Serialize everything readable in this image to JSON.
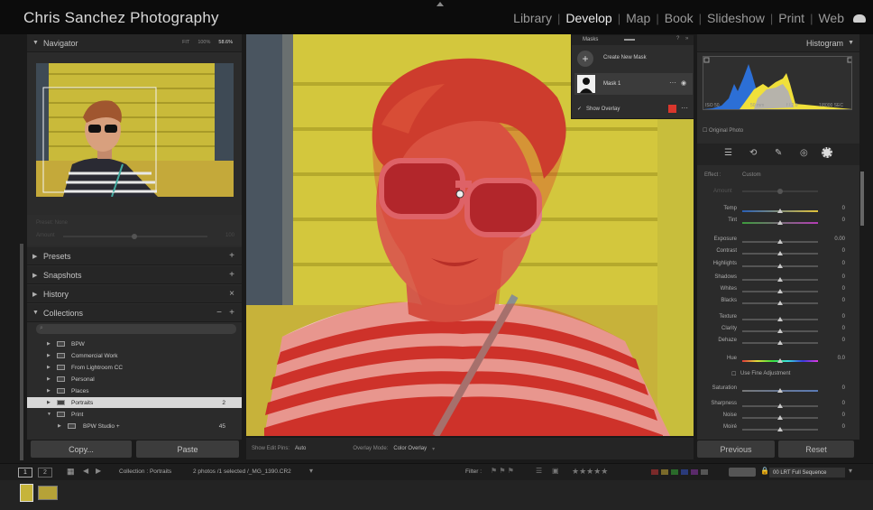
{
  "app_title": "Chris Sanchez Photography",
  "modules": [
    "Library",
    "Develop",
    "Map",
    "Book",
    "Slideshow",
    "Print",
    "Web"
  ],
  "active_module": "Develop",
  "navigator": {
    "title": "Navigator",
    "modes": [
      "FIT",
      "100%",
      "58.6%"
    ],
    "active_mode": "58.6%"
  },
  "preset_amount": {
    "label": "Preset: None",
    "amount_label": "Amount",
    "amount_value": "100"
  },
  "panels": {
    "presets": "Presets",
    "snapshots": "Snapshots",
    "history": "History",
    "collections": "Collections"
  },
  "collections": [
    {
      "label": "BPW",
      "count": ""
    },
    {
      "label": "Commercial Work",
      "count": ""
    },
    {
      "label": "From Lightroom CC",
      "count": ""
    },
    {
      "label": "Personal",
      "count": ""
    },
    {
      "label": "Places",
      "count": ""
    },
    {
      "label": "Portraits",
      "count": "2"
    },
    {
      "label": "Print",
      "count": ""
    },
    {
      "label": "BPW Studio +",
      "count": "45"
    }
  ],
  "left_buttons": {
    "copy": "Copy...",
    "paste": "Paste"
  },
  "masks": {
    "title": "Masks",
    "create_label": "Create New Mask",
    "mask1_label": "Mask 1",
    "show_overlay": "Show Overlay",
    "overlay_color": "#d9362c"
  },
  "toolbar": {
    "edit_pins_label": "Show Edit Pins:",
    "edit_pins_value": "Auto",
    "overlay_mode_label": "Overlay Mode:",
    "overlay_mode_value": "Color Overlay"
  },
  "histogram": {
    "title": "Histogram",
    "iso": "ISO 50",
    "focal": "50 mm",
    "aperture": "f / 2.0",
    "shutter": "1/8000 SEC",
    "original_photo": "Original Photo"
  },
  "effect": {
    "label": "Effect :",
    "value": "Custom",
    "amount_label": "Amount"
  },
  "sliders": [
    {
      "label": "Temp",
      "value": "0"
    },
    {
      "label": "Tint",
      "value": "0"
    },
    {
      "label": "Exposure",
      "value": "0.00"
    },
    {
      "label": "Contrast",
      "value": "0"
    },
    {
      "label": "Highlights",
      "value": "0"
    },
    {
      "label": "Shadows",
      "value": "0"
    },
    {
      "label": "Whites",
      "value": "0"
    },
    {
      "label": "Blacks",
      "value": "0"
    },
    {
      "label": "Texture",
      "value": "0"
    },
    {
      "label": "Clarity",
      "value": "0"
    },
    {
      "label": "Dehaze",
      "value": "0"
    },
    {
      "label": "Hue",
      "value": "0.0"
    },
    {
      "label": "Saturation",
      "value": "0"
    },
    {
      "label": "Sharpness",
      "value": "0"
    },
    {
      "label": "Noise",
      "value": "0"
    },
    {
      "label": "Moiré",
      "value": "0"
    }
  ],
  "fine_adjustment": "Use Fine Adjustment",
  "right_buttons": {
    "previous": "Previous",
    "reset": "Reset"
  },
  "filmbar": {
    "page1": "1",
    "page2": "2",
    "collection": "Collection : Portraits",
    "selection": "2 photos /1 selected /_MG_1390.CR2",
    "filter_label": "Filter :",
    "sequence": "00 LRT Full Sequence"
  },
  "colors": {
    "accent_active": "#eaeaea",
    "mask_overlay": "#d9362c"
  }
}
